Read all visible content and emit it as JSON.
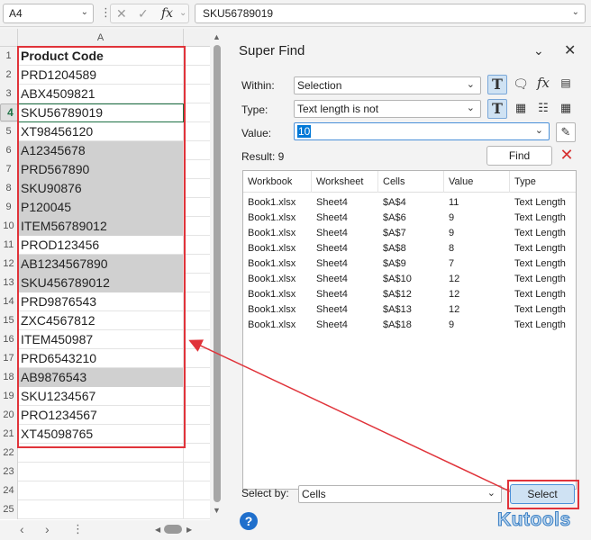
{
  "formula_bar": {
    "name_box": "A4",
    "fx_label": "fx",
    "formula": "SKU56789019"
  },
  "sheet": {
    "column_header": "A",
    "rows": [
      {
        "n": "1",
        "v": "Product Code",
        "hl": false
      },
      {
        "n": "2",
        "v": "PRD1204589",
        "hl": false
      },
      {
        "n": "3",
        "v": "ABX4509821",
        "hl": false
      },
      {
        "n": "4",
        "v": "SKU56789019",
        "hl": false
      },
      {
        "n": "5",
        "v": "XT98456120",
        "hl": false
      },
      {
        "n": "6",
        "v": "A12345678",
        "hl": true
      },
      {
        "n": "7",
        "v": "PRD567890",
        "hl": true
      },
      {
        "n": "8",
        "v": "SKU90876",
        "hl": true
      },
      {
        "n": "9",
        "v": "P120045",
        "hl": true
      },
      {
        "n": "10",
        "v": "ITEM56789012",
        "hl": true
      },
      {
        "n": "11",
        "v": "PROD123456",
        "hl": false
      },
      {
        "n": "12",
        "v": "AB1234567890",
        "hl": true
      },
      {
        "n": "13",
        "v": "SKU456789012",
        "hl": true
      },
      {
        "n": "14",
        "v": "PRD9876543",
        "hl": false
      },
      {
        "n": "15",
        "v": "ZXC4567812",
        "hl": false
      },
      {
        "n": "16",
        "v": "ITEM450987",
        "hl": false
      },
      {
        "n": "17",
        "v": "PRD6543210",
        "hl": false
      },
      {
        "n": "18",
        "v": "AB9876543",
        "hl": true
      },
      {
        "n": "19",
        "v": "SKU1234567",
        "hl": false
      },
      {
        "n": "20",
        "v": "PRO1234567",
        "hl": false
      },
      {
        "n": "21",
        "v": "XT45098765",
        "hl": false
      },
      {
        "n": "22",
        "v": "",
        "hl": false
      },
      {
        "n": "23",
        "v": "",
        "hl": false
      },
      {
        "n": "24",
        "v": "",
        "hl": false
      },
      {
        "n": "25",
        "v": "",
        "hl": false
      }
    ]
  },
  "panel": {
    "title": "Super Find",
    "within_label": "Within:",
    "within_value": "Selection",
    "type_label": "Type:",
    "type_value": "Text length is not",
    "value_label": "Value:",
    "value_value": "10",
    "find_label": "Find",
    "result_text": "Result: 9",
    "columns": [
      "Workbook",
      "Worksheet",
      "Cells",
      "Value",
      "Type"
    ],
    "results": [
      [
        "Book1.xlsx",
        "Sheet4",
        "$A$4",
        "11",
        "Text Length"
      ],
      [
        "Book1.xlsx",
        "Sheet4",
        "$A$6",
        "9",
        "Text Length"
      ],
      [
        "Book1.xlsx",
        "Sheet4",
        "$A$7",
        "9",
        "Text Length"
      ],
      [
        "Book1.xlsx",
        "Sheet4",
        "$A$8",
        "8",
        "Text Length"
      ],
      [
        "Book1.xlsx",
        "Sheet4",
        "$A$9",
        "7",
        "Text Length"
      ],
      [
        "Book1.xlsx",
        "Sheet4",
        "$A$10",
        "12",
        "Text Length"
      ],
      [
        "Book1.xlsx",
        "Sheet4",
        "$A$12",
        "12",
        "Text Length"
      ],
      [
        "Book1.xlsx",
        "Sheet4",
        "$A$13",
        "12",
        "Text Length"
      ],
      [
        "Book1.xlsx",
        "Sheet4",
        "$A$18",
        "9",
        "Text Length"
      ]
    ],
    "select_by_label": "Select by:",
    "select_by_value": "Cells",
    "select_label": "Select",
    "help_label": "?",
    "brand": "Kutools"
  },
  "colors": {
    "highlight": "#d0d0d0",
    "annotation": "#e0333a",
    "accent": "#1f6fcc"
  }
}
